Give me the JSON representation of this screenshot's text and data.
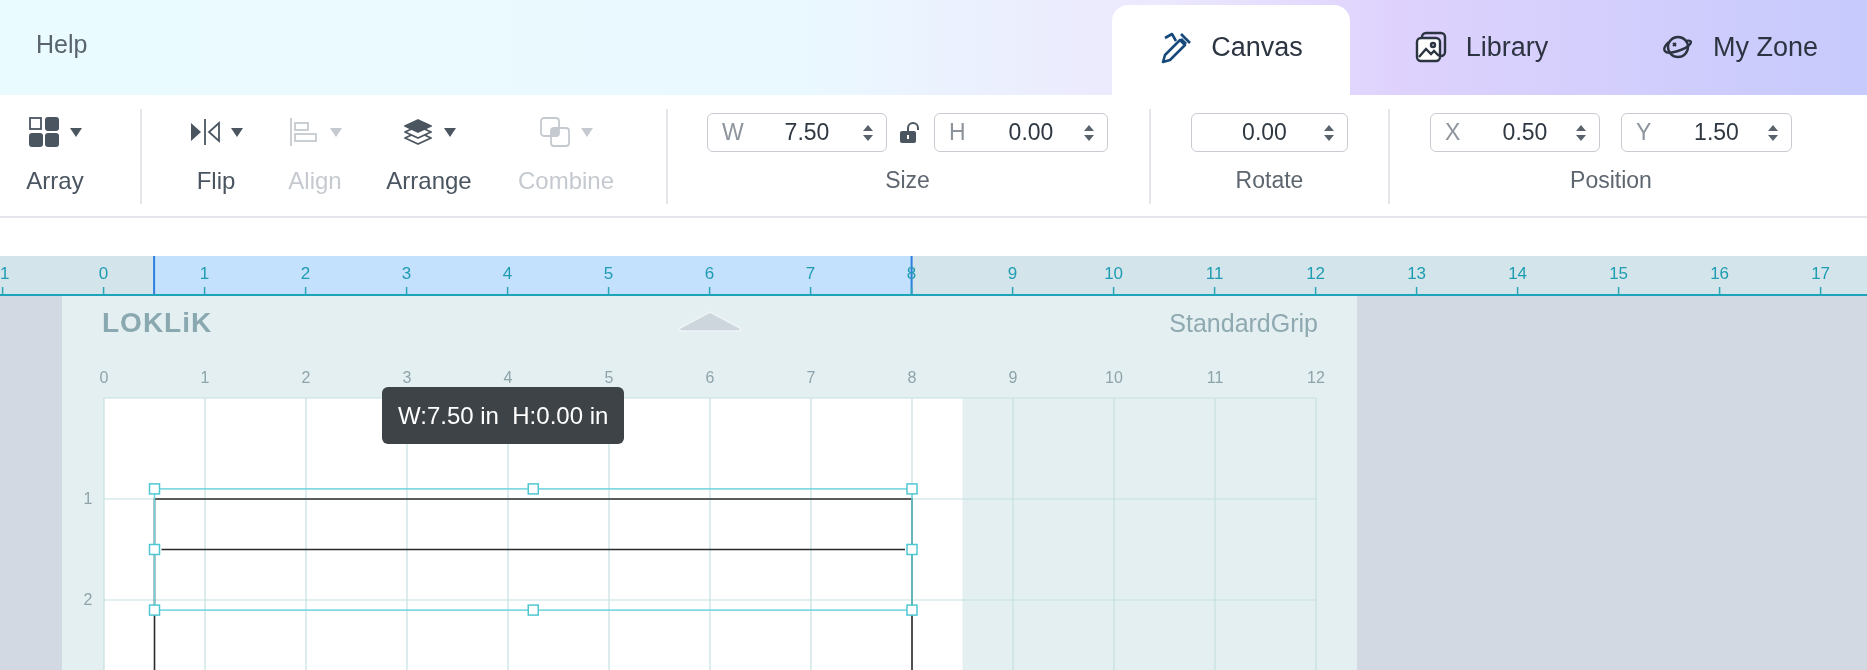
{
  "top_bar": {
    "help": "Help",
    "tabs": [
      {
        "label": "Canvas",
        "selected": true
      },
      {
        "label": "Library",
        "selected": false
      },
      {
        "label": "My Zone",
        "selected": false
      }
    ]
  },
  "toolbar": {
    "tools": [
      {
        "label": "Array",
        "disabled": false
      },
      {
        "label": "Flip",
        "disabled": false
      },
      {
        "label": "Align",
        "disabled": true
      },
      {
        "label": "Arrange",
        "disabled": false
      },
      {
        "label": "Combine",
        "disabled": true
      }
    ],
    "size": {
      "label": "Size",
      "width": {
        "prefix": "W",
        "value": "7.50"
      },
      "height": {
        "prefix": "H",
        "value": "0.00"
      },
      "locked": false
    },
    "rotate": {
      "label": "Rotate",
      "value": "0.00"
    },
    "position": {
      "label": "Position",
      "x": {
        "prefix": "X",
        "value": "0.50"
      },
      "y": {
        "prefix": "Y",
        "value": "1.50"
      }
    }
  },
  "ruler": {
    "labels": [
      "1",
      "0",
      "1",
      "2",
      "3",
      "4",
      "5",
      "6",
      "7",
      "8",
      "9",
      "10",
      "11",
      "12",
      "13",
      "14",
      "15",
      "16",
      "17"
    ]
  },
  "mat": {
    "brand": "LOKLiK",
    "type": "StandardGrip",
    "top_labels": [
      "0",
      "1",
      "2",
      "3",
      "4",
      "5",
      "6",
      "7",
      "8",
      "9",
      "10",
      "11",
      "12"
    ],
    "side_labels": [
      "1",
      "2"
    ],
    "tooltip": "W:7.50 in  H:0.00 in"
  }
}
